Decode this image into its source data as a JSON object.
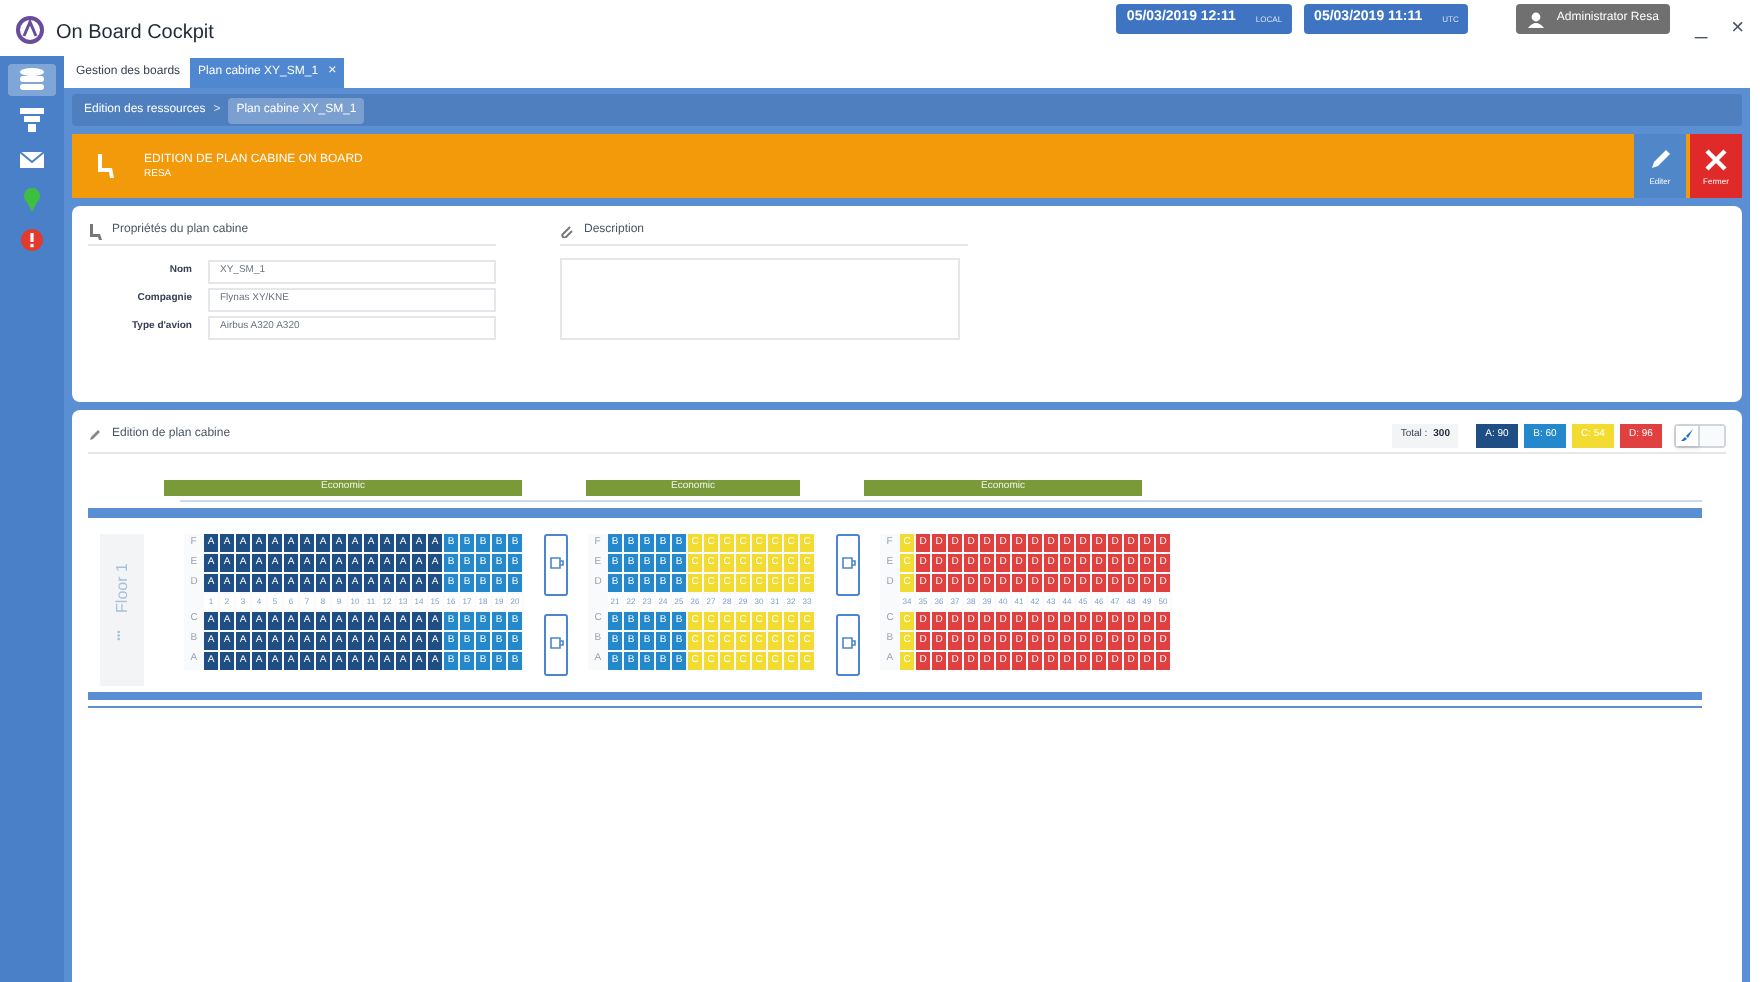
{
  "app": {
    "title": "On Board Cockpit"
  },
  "clocks": [
    {
      "time": "05/03/2019 12:11",
      "zone": "LOCAL"
    },
    {
      "time": "05/03/2019 11:11",
      "zone": "UTC"
    }
  ],
  "user": "Administrator Resa",
  "window_controls": [
    "_",
    "×"
  ],
  "sidebar": [
    {
      "kind": "layers",
      "selected": true
    },
    {
      "kind": "filter",
      "selected": false
    },
    {
      "kind": "mail",
      "selected": false
    },
    {
      "kind": "pin",
      "selected": false
    },
    {
      "kind": "alert",
      "selected": false
    }
  ],
  "tabs": [
    {
      "label": "Gestion des boards",
      "selected": false
    },
    {
      "label": "Plan cabine XY_SM_1",
      "selected": true,
      "close": "×"
    }
  ],
  "breadcrumb": {
    "items": [
      "Edition des ressources",
      "Plan cabine XY_SM_1"
    ],
    "separator": ">"
  },
  "header": {
    "title": "EDITION DE PLAN CABINE ON BOARD",
    "subtitle": "RESA",
    "actions": [
      {
        "kind": "edit",
        "label": "Editer"
      },
      {
        "kind": "close",
        "label": "Fermer"
      }
    ]
  },
  "properties": {
    "title": "Propriétés du plan cabine",
    "fields": [
      {
        "label": "Nom",
        "value": "XY_SM_1"
      },
      {
        "label": "Compagnie",
        "value": "Flynas XY/KNE"
      },
      {
        "label": "Type d'avion",
        "value": "Airbus A320 A320"
      }
    ]
  },
  "description": {
    "title": "Description"
  },
  "cabin": {
    "title": "Edition de plan cabine",
    "total_label": "Total :",
    "total": "300",
    "legend": [
      {
        "label": "A: 90",
        "color": "#1f4e85"
      },
      {
        "label": "B: 60",
        "color": "#2489cc"
      },
      {
        "label": "C: 54",
        "color": "#f2dc32"
      },
      {
        "label": "D: 96",
        "color": "#e04040"
      }
    ],
    "view_toggle": [
      {
        "kind": "brush",
        "selected": true
      },
      {
        "kind": "blank",
        "selected": false
      }
    ],
    "floor": {
      "label": "Floor 1",
      "dots": "•••"
    },
    "sections": [
      {
        "cabin_class": "Economic",
        "galley_before": false,
        "top_labels": [
          "F",
          "E",
          "D"
        ],
        "bottom_labels": [
          "C",
          "B",
          "A"
        ],
        "rows": [
          {
            "number": "1",
            "color": "#1f4e85",
            "seats": [
              "A",
              "A",
              "A",
              "A",
              "A",
              "A"
            ]
          },
          {
            "number": "2",
            "color": "#1f4e85",
            "seats": [
              "A",
              "A",
              "A",
              "A",
              "A",
              "A"
            ]
          },
          {
            "number": "3",
            "color": "#1f4e85",
            "seats": [
              "A",
              "A",
              "A",
              "A",
              "A",
              "A"
            ]
          },
          {
            "number": "4",
            "color": "#1f4e85",
            "seats": [
              "A",
              "A",
              "A",
              "A",
              "A",
              "A"
            ]
          },
          {
            "number": "5",
            "color": "#1f4e85",
            "seats": [
              "A",
              "A",
              "A",
              "A",
              "A",
              "A"
            ]
          },
          {
            "number": "6",
            "color": "#1f4e85",
            "seats": [
              "A",
              "A",
              "A",
              "A",
              "A",
              "A"
            ]
          },
          {
            "number": "7",
            "color": "#1f4e85",
            "seats": [
              "A",
              "A",
              "A",
              "A",
              "A",
              "A"
            ]
          },
          {
            "number": "8",
            "color": "#1f4e85",
            "seats": [
              "A",
              "A",
              "A",
              "A",
              "A",
              "A"
            ]
          },
          {
            "number": "9",
            "color": "#1f4e85",
            "seats": [
              "A",
              "A",
              "A",
              "A",
              "A",
              "A"
            ]
          },
          {
            "number": "10",
            "color": "#1f4e85",
            "seats": [
              "A",
              "A",
              "A",
              "A",
              "A",
              "A"
            ]
          },
          {
            "number": "11",
            "color": "#1f4e85",
            "seats": [
              "A",
              "A",
              "A",
              "A",
              "A",
              "A"
            ]
          },
          {
            "number": "12",
            "color": "#1f4e85",
            "seats": [
              "A",
              "A",
              "A",
              "A",
              "A",
              "A"
            ]
          },
          {
            "number": "13",
            "color": "#1f4e85",
            "seats": [
              "A",
              "A",
              "A",
              "A",
              "A",
              "A"
            ]
          },
          {
            "number": "14",
            "color": "#1f4e85",
            "seats": [
              "A",
              "A",
              "A",
              "A",
              "A",
              "A"
            ]
          },
          {
            "number": "15",
            "color": "#1f4e85",
            "seats": [
              "A",
              "A",
              "A",
              "A",
              "A",
              "A"
            ]
          },
          {
            "number": "16",
            "color": "#2489cc",
            "seats": [
              "B",
              "B",
              "B",
              "B",
              "B",
              "B"
            ]
          },
          {
            "number": "17",
            "color": "#2489cc",
            "seats": [
              "B",
              "B",
              "B",
              "B",
              "B",
              "B"
            ]
          },
          {
            "number": "18",
            "color": "#2489cc",
            "seats": [
              "B",
              "B",
              "B",
              "B",
              "B",
              "B"
            ]
          },
          {
            "number": "19",
            "color": "#2489cc",
            "seats": [
              "B",
              "B",
              "B",
              "B",
              "B",
              "B"
            ]
          },
          {
            "number": "20",
            "color": "#2489cc",
            "seats": [
              "B",
              "B",
              "B",
              "B",
              "B",
              "B"
            ]
          }
        ]
      },
      {
        "cabin_class": "Economic",
        "galley_before": true,
        "top_labels": [
          "F",
          "E",
          "D"
        ],
        "bottom_labels": [
          "C",
          "B",
          "A"
        ],
        "rows": [
          {
            "number": "21",
            "color": "#2489cc",
            "seats": [
              "B",
              "B",
              "B",
              "B",
              "B",
              "B"
            ]
          },
          {
            "number": "22",
            "color": "#2489cc",
            "seats": [
              "B",
              "B",
              "B",
              "B",
              "B",
              "B"
            ]
          },
          {
            "number": "23",
            "color": "#2489cc",
            "seats": [
              "B",
              "B",
              "B",
              "B",
              "B",
              "B"
            ]
          },
          {
            "number": "24",
            "color": "#2489cc",
            "seats": [
              "B",
              "B",
              "B",
              "B",
              "B",
              "B"
            ]
          },
          {
            "number": "25",
            "color": "#2489cc",
            "seats": [
              "B",
              "B",
              "B",
              "B",
              "B",
              "B"
            ]
          },
          {
            "number": "26",
            "color": "#f2dc32",
            "seats": [
              "C",
              "C",
              "C",
              "C",
              "C",
              "C"
            ]
          },
          {
            "number": "27",
            "color": "#f2dc32",
            "seats": [
              "C",
              "C",
              "C",
              "C",
              "C",
              "C"
            ]
          },
          {
            "number": "28",
            "color": "#f2dc32",
            "seats": [
              "C",
              "C",
              "C",
              "C",
              "C",
              "C"
            ]
          },
          {
            "number": "29",
            "color": "#f2dc32",
            "seats": [
              "C",
              "C",
              "C",
              "C",
              "C",
              "C"
            ]
          },
          {
            "number": "30",
            "color": "#f2dc32",
            "seats": [
              "C",
              "C",
              "C",
              "C",
              "C",
              "C"
            ]
          },
          {
            "number": "31",
            "color": "#f2dc32",
            "seats": [
              "C",
              "C",
              "C",
              "C",
              "C",
              "C"
            ]
          },
          {
            "number": "32",
            "color": "#f2dc32",
            "seats": [
              "C",
              "C",
              "C",
              "C",
              "C",
              "C"
            ]
          },
          {
            "number": "33",
            "color": "#f2dc32",
            "seats": [
              "C",
              "C",
              "C",
              "C",
              "C",
              "C"
            ]
          }
        ]
      },
      {
        "cabin_class": "Economic",
        "galley_before": true,
        "top_labels": [
          "F",
          "E",
          "D"
        ],
        "bottom_labels": [
          "C",
          "B",
          "A"
        ],
        "rows": [
          {
            "number": "34",
            "color": "#f2dc32",
            "seats": [
              "C",
              "C",
              "C",
              "C",
              "C",
              "C"
            ]
          },
          {
            "number": "35",
            "color": "#e04040",
            "seats": [
              "D",
              "D",
              "D",
              "D",
              "D",
              "D"
            ]
          },
          {
            "number": "36",
            "color": "#e04040",
            "seats": [
              "D",
              "D",
              "D",
              "D",
              "D",
              "D"
            ]
          },
          {
            "number": "37",
            "color": "#e04040",
            "seats": [
              "D",
              "D",
              "D",
              "D",
              "D",
              "D"
            ]
          },
          {
            "number": "38",
            "color": "#e04040",
            "seats": [
              "D",
              "D",
              "D",
              "D",
              "D",
              "D"
            ]
          },
          {
            "number": "39",
            "color": "#e04040",
            "seats": [
              "D",
              "D",
              "D",
              "D",
              "D",
              "D"
            ]
          },
          {
            "number": "40",
            "color": "#e04040",
            "seats": [
              "D",
              "D",
              "D",
              "D",
              "D",
              "D"
            ]
          },
          {
            "number": "41",
            "color": "#e04040",
            "seats": [
              "D",
              "D",
              "D",
              "D",
              "D",
              "D"
            ]
          },
          {
            "number": "42",
            "color": "#e04040",
            "seats": [
              "D",
              "D",
              "D",
              "D",
              "D",
              "D"
            ]
          },
          {
            "number": "43",
            "color": "#e04040",
            "seats": [
              "D",
              "D",
              "D",
              "D",
              "D",
              "D"
            ]
          },
          {
            "number": "44",
            "color": "#e04040",
            "seats": [
              "D",
              "D",
              "D",
              "D",
              "D",
              "D"
            ]
          },
          {
            "number": "45",
            "color": "#e04040",
            "seats": [
              "D",
              "D",
              "D",
              "D",
              "D",
              "D"
            ]
          },
          {
            "number": "46",
            "color": "#e04040",
            "seats": [
              "D",
              "D",
              "D",
              "D",
              "D",
              "D"
            ]
          },
          {
            "number": "47",
            "color": "#e04040",
            "seats": [
              "D",
              "D",
              "D",
              "D",
              "D",
              "D"
            ]
          },
          {
            "number": "48",
            "color": "#e04040",
            "seats": [
              "D",
              "D",
              "D",
              "D",
              "D",
              "D"
            ]
          },
          {
            "number": "49",
            "color": "#e04040",
            "seats": [
              "D",
              "D",
              "D",
              "D",
              "D",
              "D"
            ]
          },
          {
            "number": "50",
            "color": "#e04040",
            "seats": [
              "D",
              "D",
              "D",
              "D",
              "D",
              "D"
            ]
          }
        ]
      }
    ]
  }
}
